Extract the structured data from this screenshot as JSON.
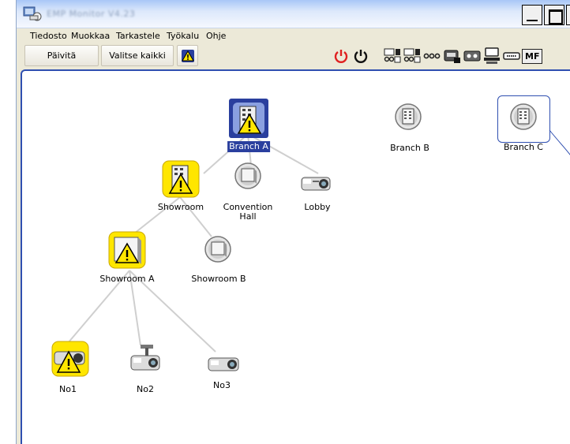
{
  "window": {
    "title": "EMP Monitor V4.23"
  },
  "menu": [
    "Tiedosto",
    "Muokkaa",
    "Tarkastele",
    "Työkalu",
    "Ohje"
  ],
  "toolbar": {
    "refresh_label": "Päivitä",
    "select_all_label": "Valitse kaikki",
    "icons": [
      "warning-filter-icon",
      "power-on-red-icon",
      "power-off-icon",
      "input-1-icon",
      "input-2-icon",
      "more-inputs-icon",
      "video-icon",
      "svideo-icon",
      "computer-icon",
      "dvi-icon",
      "mf-icon"
    ],
    "mf_text": "MF"
  },
  "tree": {
    "nodes": [
      {
        "id": "branch_a",
        "label": "Branch A",
        "kind": "building",
        "warning": true,
        "selected": true
      },
      {
        "id": "showroom",
        "label": "Showroom",
        "kind": "building",
        "warning": true
      },
      {
        "id": "convention_hall",
        "label": "Convention Hall",
        "kind": "group",
        "warning": false
      },
      {
        "id": "lobby",
        "label": "Lobby",
        "kind": "projector",
        "warning": false
      },
      {
        "id": "showroom_a",
        "label": "Showroom A",
        "kind": "group",
        "warning": true
      },
      {
        "id": "showroom_b",
        "label": "Showroom B",
        "kind": "group",
        "warning": false
      },
      {
        "id": "no1",
        "label": "No1",
        "kind": "projector",
        "warning": true
      },
      {
        "id": "no2",
        "label": "No2",
        "kind": "ceiling-projector",
        "warning": false
      },
      {
        "id": "no3",
        "label": "No3",
        "kind": "projector",
        "warning": false
      },
      {
        "id": "branch_b",
        "label": "Branch B",
        "kind": "building",
        "warning": false
      },
      {
        "id": "branch_c",
        "label": "Branch C",
        "kind": "building",
        "warning": false,
        "framed": true
      }
    ],
    "convention_hall_lines": [
      "Convention",
      "Hall"
    ]
  },
  "colors": {
    "warning": "#ffe600",
    "selection": "#2a3f9e",
    "frame": "#2f4fb0"
  }
}
